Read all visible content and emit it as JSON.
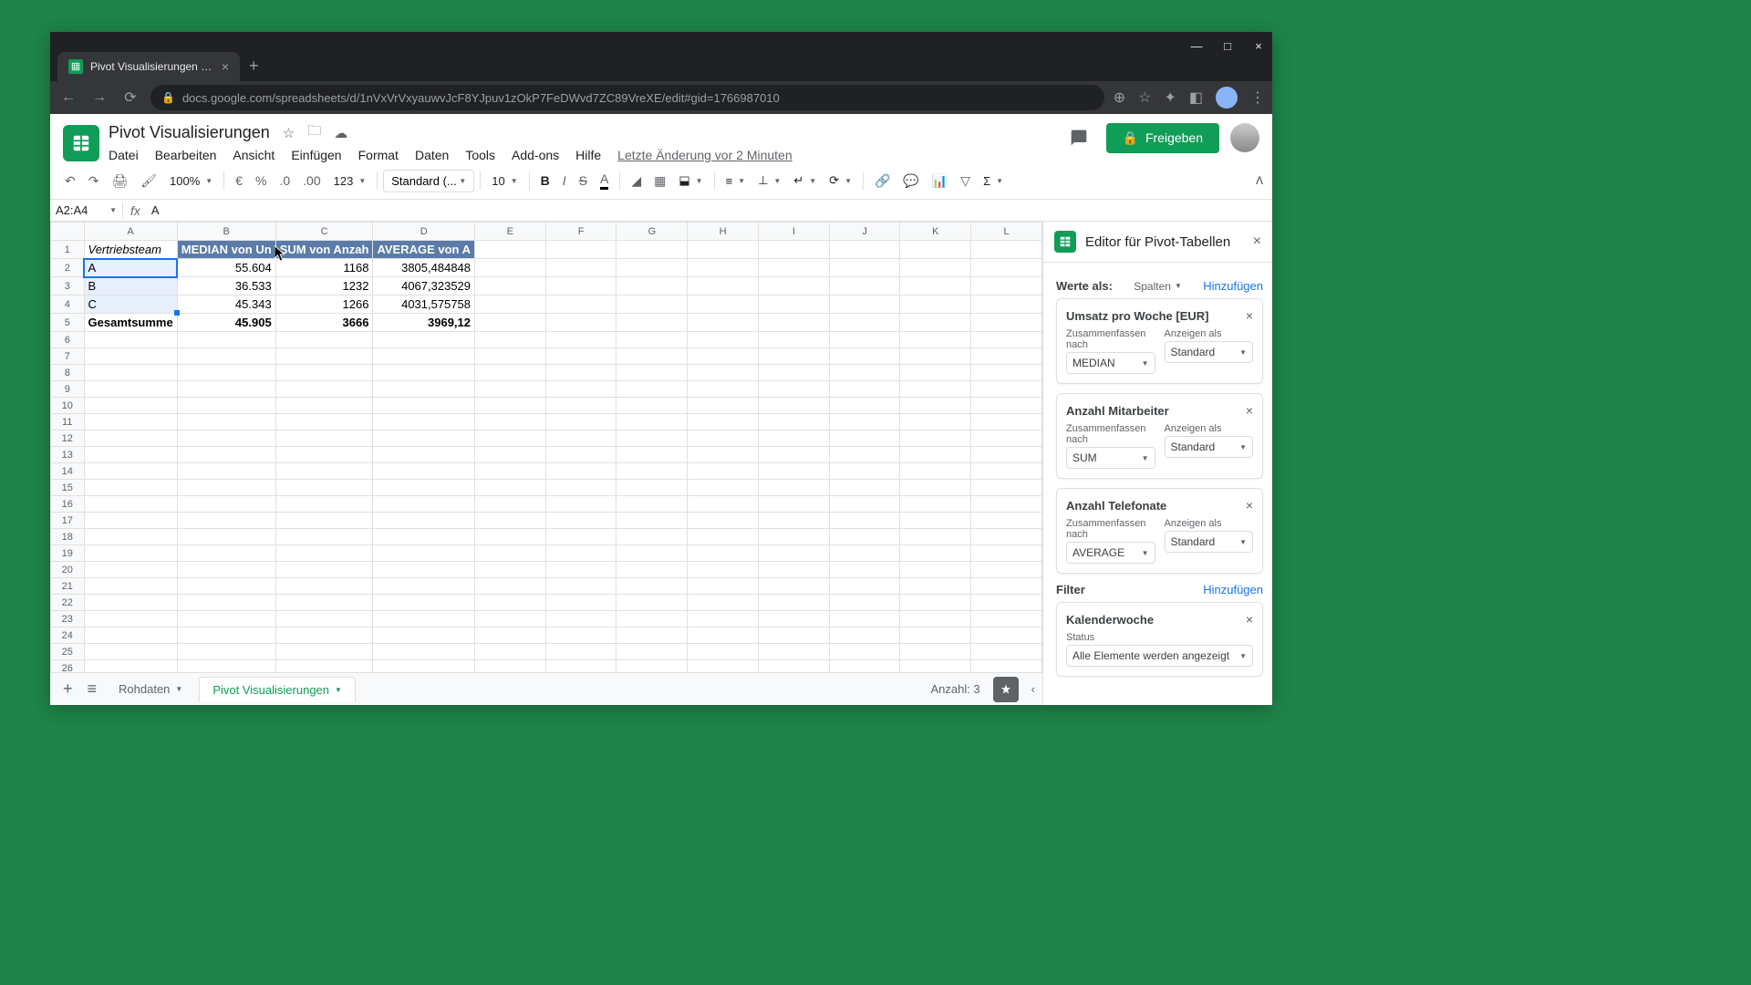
{
  "browser": {
    "tab_title": "Pivot Visualisierungen - Google",
    "url": "docs.google.com/spreadsheets/d/1nVxVrVxyauwvJcF8YJpuv1zOkP7FeDWvd7ZC89VreXE/edit#gid=1766987010"
  },
  "app": {
    "doc_title": "Pivot Visualisierungen",
    "menus": [
      "Datei",
      "Bearbeiten",
      "Ansicht",
      "Einfügen",
      "Format",
      "Daten",
      "Tools",
      "Add-ons",
      "Hilfe"
    ],
    "last_edit": "Letzte Änderung vor 2 Minuten",
    "share": "Freigeben"
  },
  "toolbar": {
    "zoom": "100%",
    "currency": "€",
    "percent": "%",
    "dec0": ".0",
    "dec00": ".00",
    "fmt123": "123",
    "font": "Standard (...",
    "size": "10",
    "bold": "B",
    "italic": "I",
    "strike": "S",
    "textcolor": "A"
  },
  "namebox": "A2:A4",
  "fx": "fx",
  "formula": "A",
  "cols": [
    "A",
    "B",
    "C",
    "D",
    "E",
    "F",
    "G",
    "H",
    "I",
    "J",
    "K",
    "L"
  ],
  "rows": {
    "r1": {
      "A": "Vertriebsteam",
      "B": "MEDIAN von Un",
      "C": "SUM von Anzah",
      "D": "AVERAGE von A"
    },
    "r2": {
      "A": "A",
      "B": "55.604",
      "C": "1168",
      "D": "3805,484848"
    },
    "r3": {
      "A": "B",
      "B": "36.533",
      "C": "1232",
      "D": "4067,323529"
    },
    "r4": {
      "A": "C",
      "B": "45.343",
      "C": "1266",
      "D": "4031,575758"
    },
    "r5": {
      "A": "Gesamtsumme",
      "B": "45.905",
      "C": "3666",
      "D": "3969,12"
    }
  },
  "tabs": {
    "raw": "Rohdaten",
    "pivot": "Pivot Visualisierungen",
    "count": "Anzahl: 3"
  },
  "side": {
    "title": "Editor für Pivot-Tabellen",
    "values_label": "Werte als:",
    "values_as": "Spalten",
    "add": "Hinzufügen",
    "sum_by": "Zusammenfassen nach",
    "show_as": "Anzeigen als",
    "std": "Standard",
    "v1": {
      "title": "Umsatz pro Woche [EUR]",
      "agg": "MEDIAN"
    },
    "v2": {
      "title": "Anzahl Mitarbeiter",
      "agg": "SUM"
    },
    "v3": {
      "title": "Anzahl Telefonate",
      "agg": "AVERAGE"
    },
    "filter_label": "Filter",
    "f1": {
      "title": "Kalenderwoche",
      "status_label": "Status",
      "status": "Alle Elemente werden angezeigt"
    }
  }
}
